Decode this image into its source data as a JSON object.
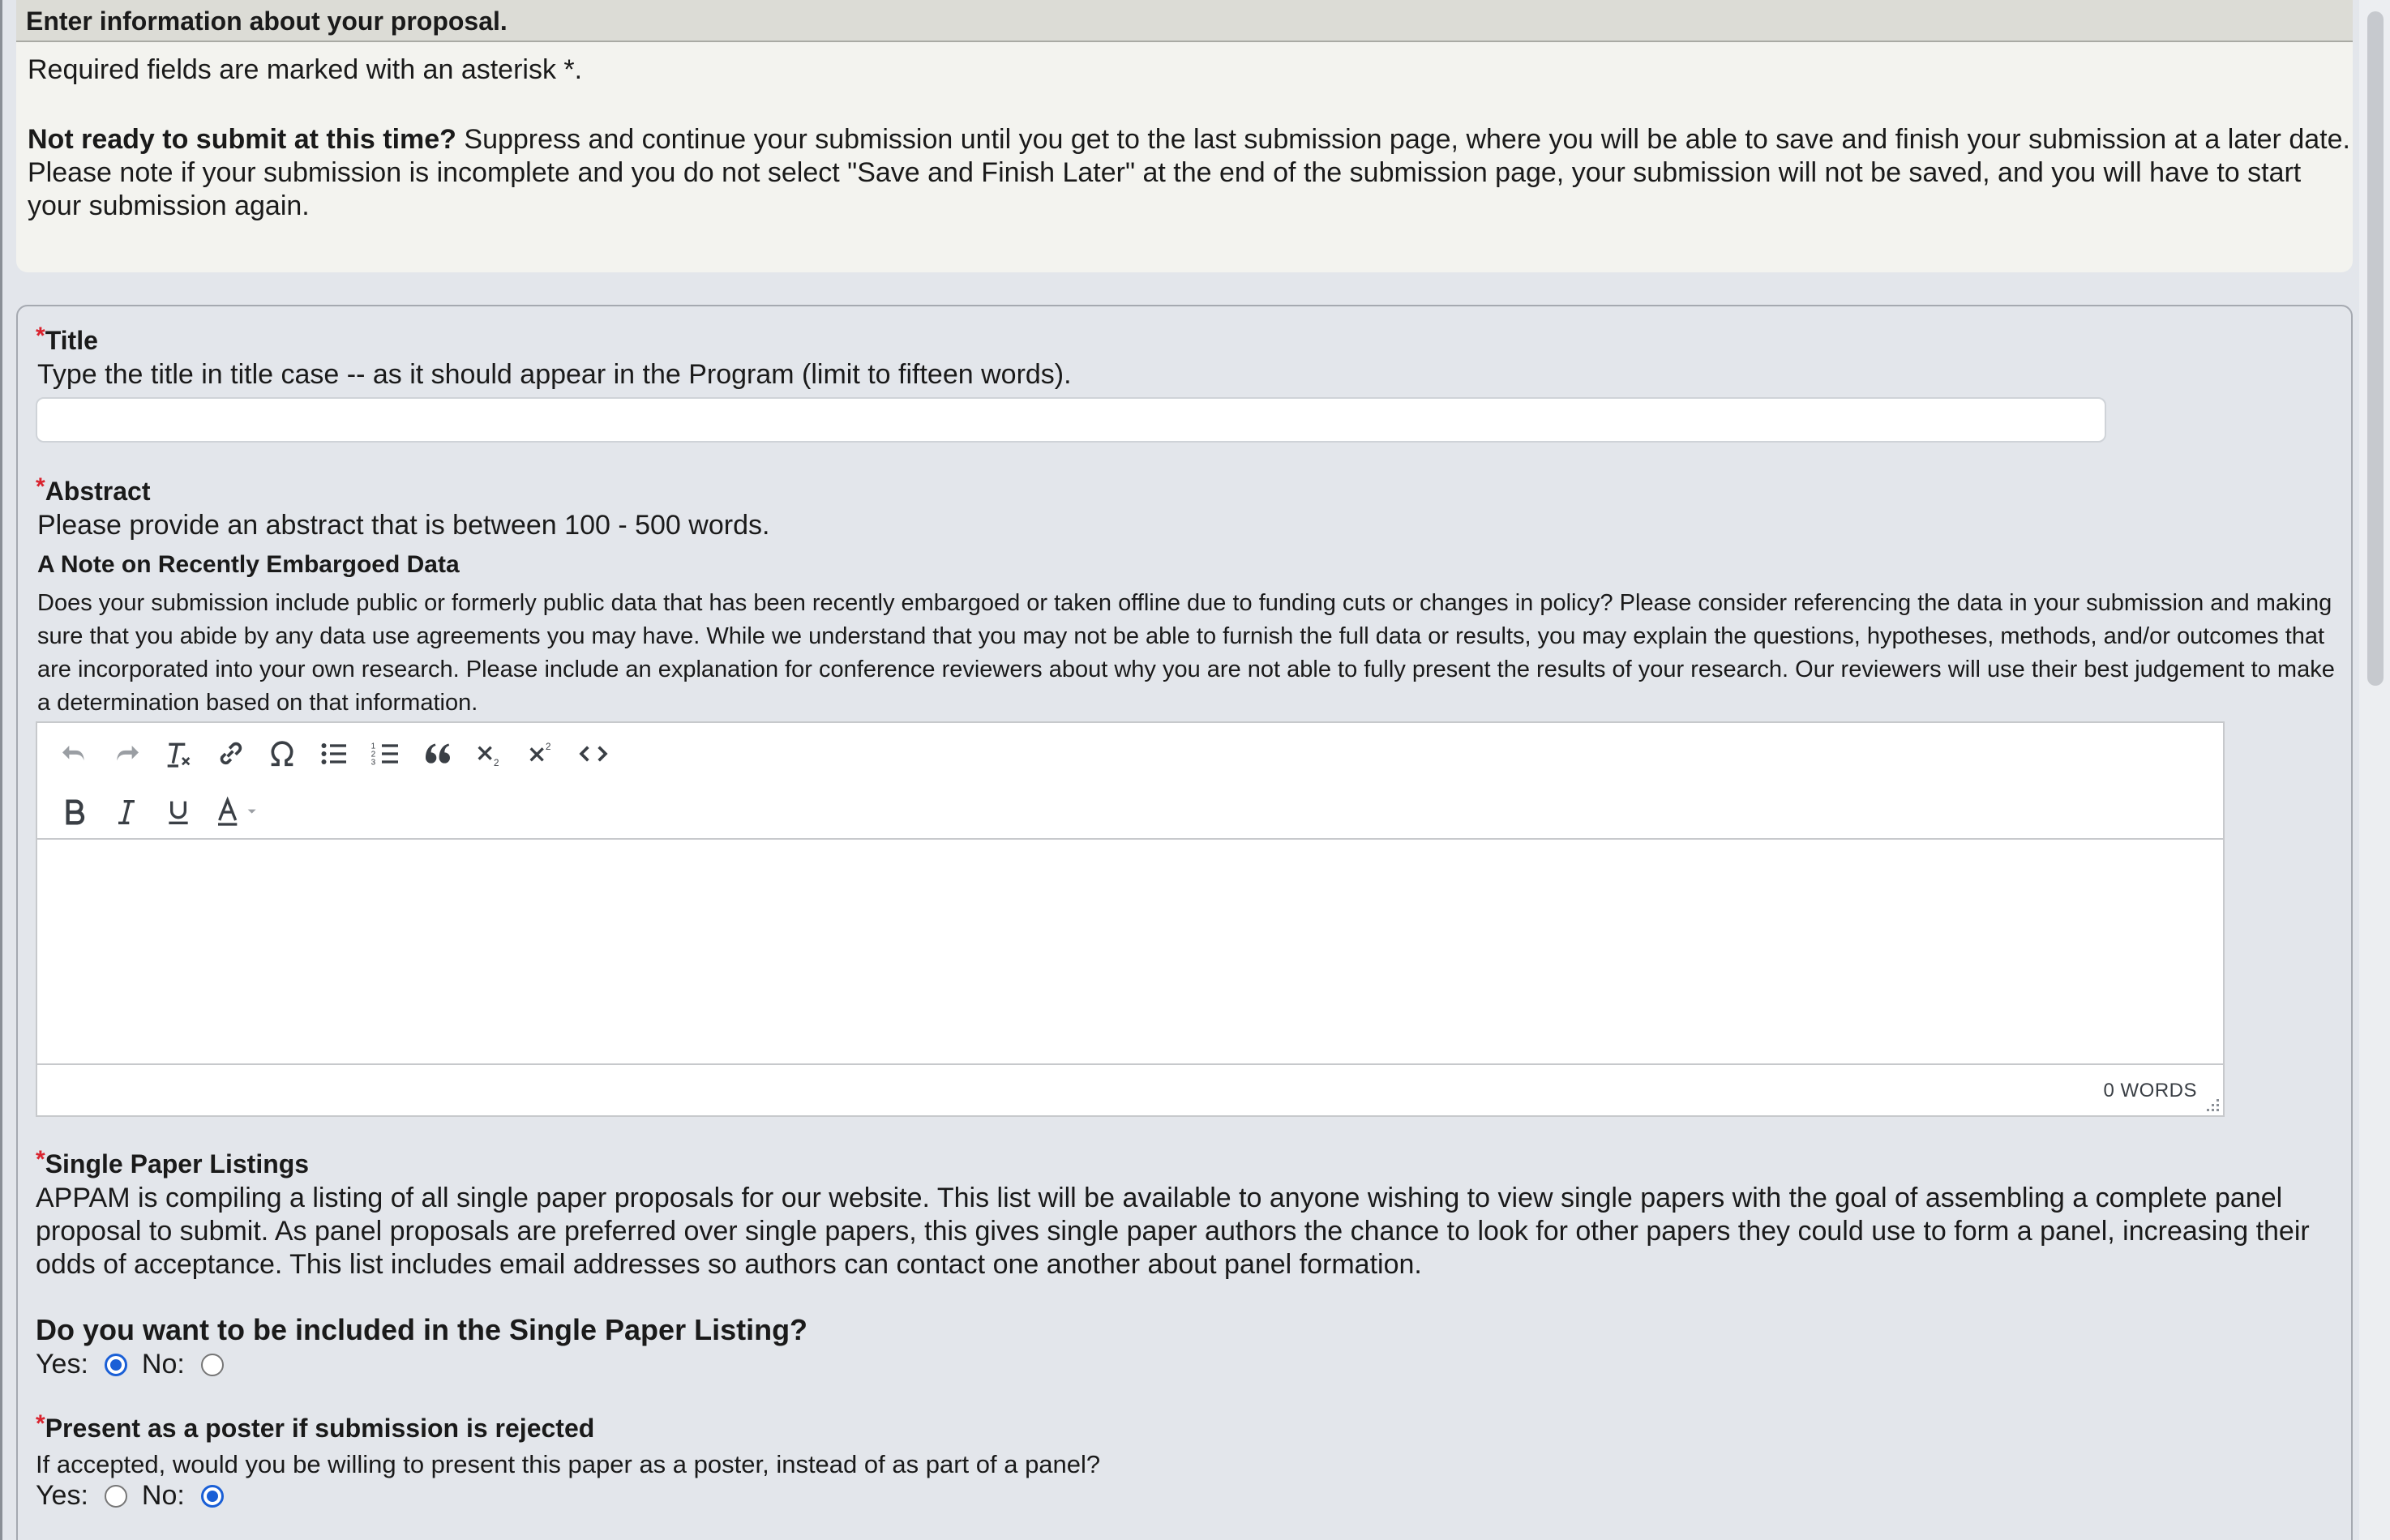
{
  "header": {
    "title": "Enter information about your proposal."
  },
  "intro": {
    "required_note": "Required fields are marked with an asterisk *.",
    "not_ready_bold": "Not ready to submit at this time?",
    "not_ready_text": " Suppress and continue your submission until you get to the last submission page, where you will be able to save and finish your submission at a later date. Please note if your submission is incomplete and you do not select \"Save and Finish Later\" at the end of the submission page, your submission will not be saved, and you will have to start your submission again."
  },
  "fields": {
    "title": {
      "asterisk": "*",
      "label": "Title",
      "help": "Type the title in title case -- as it should appear in the Program (limit to fifteen words).",
      "value": ""
    },
    "abstract": {
      "asterisk": "*",
      "label": "Abstract",
      "help": "Please provide an abstract that is between 100 - 500 words.",
      "note_heading": "A Note on Recently Embargoed Data",
      "note_text": "Does your submission include public or formerly public data that has been recently embargoed or taken offline due to funding cuts or changes in policy? Please consider referencing the data in your submission and making sure that you abide by any data use agreements you may have. While we understand that you may not be able to furnish the full data or results, you may explain the questions, hypotheses, methods, and/or outcomes that are incorporated into your own research. Please include an explanation for conference reviewers about why you are not able to fully present the results of your research.  Our reviewers will use their best judgement to make a determination based on that information.",
      "editor": {
        "toolbar_row1": [
          "undo-icon",
          "redo-icon",
          "clear-formatting-icon",
          "link-icon",
          "special-character-icon",
          "bullet-list-icon",
          "numbered-list-icon",
          "blockquote-icon",
          "subscript-icon",
          "superscript-icon",
          "source-code-icon"
        ],
        "toolbar_row2": [
          "bold-icon",
          "italic-icon",
          "underline-icon",
          "text-color-icon"
        ],
        "word_count": "0 WORDS"
      }
    },
    "single_paper": {
      "asterisk": "*",
      "label": "Single Paper Listings",
      "description": "APPAM is compiling a listing of all single paper proposals for our website. This list will be available to anyone wishing to view single papers with the goal of assembling a complete panel proposal to submit. As panel proposals are preferred over single papers, this gives single paper authors the chance to look for other papers they could use to form a panel, increasing their odds of acceptance. This list includes email addresses so authors can contact one another about panel formation.",
      "question": "Do you want to be included in the Single Paper Listing?",
      "yes_label": "Yes:",
      "no_label": "No:",
      "selected": "Yes"
    },
    "poster": {
      "asterisk": "*",
      "label": "Present as a poster if submission is rejected",
      "question": "If accepted, would you be willing to present this paper as a poster, instead of as part of a panel?",
      "yes_label": "Yes:",
      "no_label": "No:",
      "selected": "No"
    }
  },
  "colors": {
    "required": "#d9232e",
    "radio_selected": "#1a5fd6",
    "intro_bg": "#f3f3ef",
    "panel_bg": "#e3e6eb"
  }
}
